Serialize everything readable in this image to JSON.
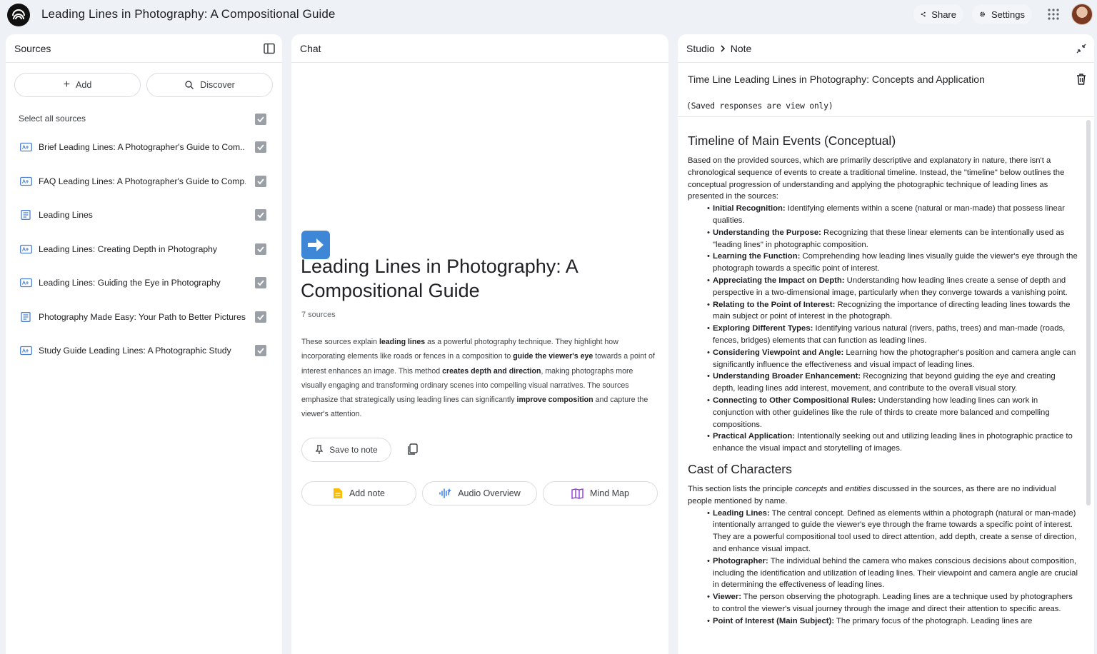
{
  "app": {
    "title": "Leading Lines in Photography: A Compositional Guide",
    "share_label": "Share",
    "settings_label": "Settings"
  },
  "sources_panel": {
    "title": "Sources",
    "add_label": "Add",
    "discover_label": "Discover",
    "select_all_label": "Select all sources",
    "items": [
      {
        "name": "Brief Leading Lines: A Photographer's Guide to Com...",
        "icon": "pdf-source-icon",
        "checked": true
      },
      {
        "name": "FAQ Leading Lines: A Photographer's Guide to Comp...",
        "icon": "pdf-source-icon",
        "checked": true
      },
      {
        "name": "Leading Lines",
        "icon": "text-source-icon",
        "checked": true
      },
      {
        "name": "Leading Lines: Creating Depth in Photography",
        "icon": "pdf-source-icon",
        "checked": true
      },
      {
        "name": "Leading Lines: Guiding the Eye in Photography",
        "icon": "pdf-source-icon",
        "checked": true
      },
      {
        "name": "Photography Made Easy: Your Path to Better Pictures",
        "icon": "text-source-icon",
        "checked": true
      },
      {
        "name": "Study Guide Leading Lines: A Photographic Study",
        "icon": "pdf-source-icon",
        "checked": true
      }
    ]
  },
  "chat_panel": {
    "title": "Chat",
    "notebook_title": "Leading Lines in Photography: A Compositional Guide",
    "sources_count": "7 sources",
    "summary": [
      {
        "t": "These sources explain ",
        "b": false
      },
      {
        "t": "leading lines",
        "b": true
      },
      {
        "t": " as a powerful photography technique. They highlight how incorporating elements like roads or fences in a composition to ",
        "b": false
      },
      {
        "t": "guide the viewer's eye",
        "b": true
      },
      {
        "t": " towards a point of interest enhances an image. This method ",
        "b": false
      },
      {
        "t": "creates depth and direction",
        "b": true
      },
      {
        "t": ", making photographs more visually engaging and transforming ordinary scenes into compelling visual narratives. The sources emphasize that strategically using leading lines can significantly ",
        "b": false
      },
      {
        "t": "improve composition",
        "b": true
      },
      {
        "t": " and capture the viewer's attention.",
        "b": false
      }
    ],
    "save_to_note_label": "Save to note",
    "add_note_label": "Add note",
    "audio_overview_label": "Audio Overview",
    "mind_map_label": "Mind Map"
  },
  "studio_panel": {
    "crumb_root": "Studio",
    "crumb_current": "Note",
    "note_title": "Time Line Leading Lines in Photography: Concepts and Application",
    "readonly_notice": "(Saved responses are view only)",
    "sections": [
      {
        "heading": "Timeline of Main Events (Conceptual)",
        "intro": [
          {
            "t": "Based on the provided sources, which are primarily descriptive and explanatory in nature, there isn't a chronological sequence of events to create a traditional timeline. Instead, the \"timeline\" below outlines the conceptual progression of understanding and applying the photographic technique of leading lines as presented in the sources:",
            "i": false
          }
        ],
        "items": [
          {
            "term": "Initial Recognition:",
            "text": " Identifying elements within a scene (natural or man-made) that possess linear qualities."
          },
          {
            "term": "Understanding the Purpose:",
            "text": " Recognizing that these linear elements can be intentionally used as \"leading lines\" in photographic composition."
          },
          {
            "term": "Learning the Function:",
            "text": " Comprehending how leading lines visually guide the viewer's eye through the photograph towards a specific point of interest."
          },
          {
            "term": "Appreciating the Impact on Depth:",
            "text": " Understanding how leading lines create a sense of depth and perspective in a two-dimensional image, particularly when they converge towards a vanishing point."
          },
          {
            "term": "Relating to the Point of Interest:",
            "text": " Recognizing the importance of directing leading lines towards the main subject or point of interest in the photograph."
          },
          {
            "term": "Exploring Different Types:",
            "text": " Identifying various natural (rivers, paths, trees) and man-made (roads, fences, bridges) elements that can function as leading lines."
          },
          {
            "term": "Considering Viewpoint and Angle:",
            "text": " Learning how the photographer's position and camera angle can significantly influence the effectiveness and visual impact of leading lines."
          },
          {
            "term": "Understanding Broader Enhancement:",
            "text": " Recognizing that beyond guiding the eye and creating depth, leading lines add interest, movement, and contribute to the overall visual story."
          },
          {
            "term": "Connecting to Other Compositional Rules:",
            "text": " Understanding how leading lines can work in conjunction with other guidelines like the rule of thirds to create more balanced and compelling compositions."
          },
          {
            "term": "Practical Application:",
            "text": " Intentionally seeking out and utilizing leading lines in photographic practice to enhance the visual impact and storytelling of images."
          }
        ]
      },
      {
        "heading": "Cast of Characters",
        "intro": [
          {
            "t": "This section lists the principle ",
            "i": false
          },
          {
            "t": "concepts",
            "i": true
          },
          {
            "t": " and ",
            "i": false
          },
          {
            "t": "entities",
            "i": true
          },
          {
            "t": " discussed in the sources, as there are no individual people mentioned by name.",
            "i": false
          }
        ],
        "items": [
          {
            "term": "Leading Lines:",
            "text": " The central concept. Defined as elements within a photograph (natural or man-made) intentionally arranged to guide the viewer's eye through the frame towards a specific point of interest. They are a powerful compositional tool used to direct attention, add depth, create a sense of direction, and enhance visual impact."
          },
          {
            "term": "Photographer:",
            "text": " The individual behind the camera who makes conscious decisions about composition, including the identification and utilization of leading lines. Their viewpoint and camera angle are crucial in determining the effectiveness of leading lines."
          },
          {
            "term": "Viewer:",
            "text": " The person observing the photograph. Leading lines are a technique used by photographers to control the viewer's visual journey through the image and direct their attention to specific areas."
          },
          {
            "term": "Point of Interest (Main Subject):",
            "text": " The primary focus of the photograph. Leading lines are"
          }
        ]
      }
    ]
  }
}
